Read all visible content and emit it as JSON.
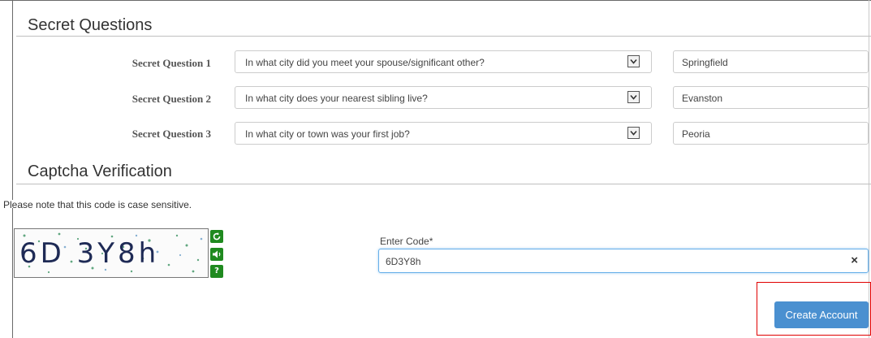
{
  "secret_questions": {
    "title": "Secret Questions",
    "items": [
      {
        "label": "Secret Question 1",
        "question": "In what city did you meet your spouse/significant other?",
        "answer": "Springfield"
      },
      {
        "label": "Secret Question 2",
        "question": "In what city does your nearest sibling live?",
        "answer": "Evanston"
      },
      {
        "label": "Secret Question 3",
        "question": "In what city or town was your first job?",
        "answer": "Peoria"
      }
    ]
  },
  "captcha": {
    "title": "Captcha Verification",
    "note": "Please note that this code is case sensitive.",
    "image_text": "6D 3Y8h",
    "refresh_icon": "refresh-icon",
    "audio_icon": "audio-icon",
    "help_icon": "help-icon",
    "help_label": "?",
    "code_label": "Enter Code*",
    "code_value": "6D3Y8h",
    "clear_label": "×"
  },
  "actions": {
    "create_label": "Create Account"
  },
  "colors": {
    "primary_button": "#4a90d0",
    "captcha_buttons": "#1f8a1f",
    "highlight": "#e00000"
  }
}
